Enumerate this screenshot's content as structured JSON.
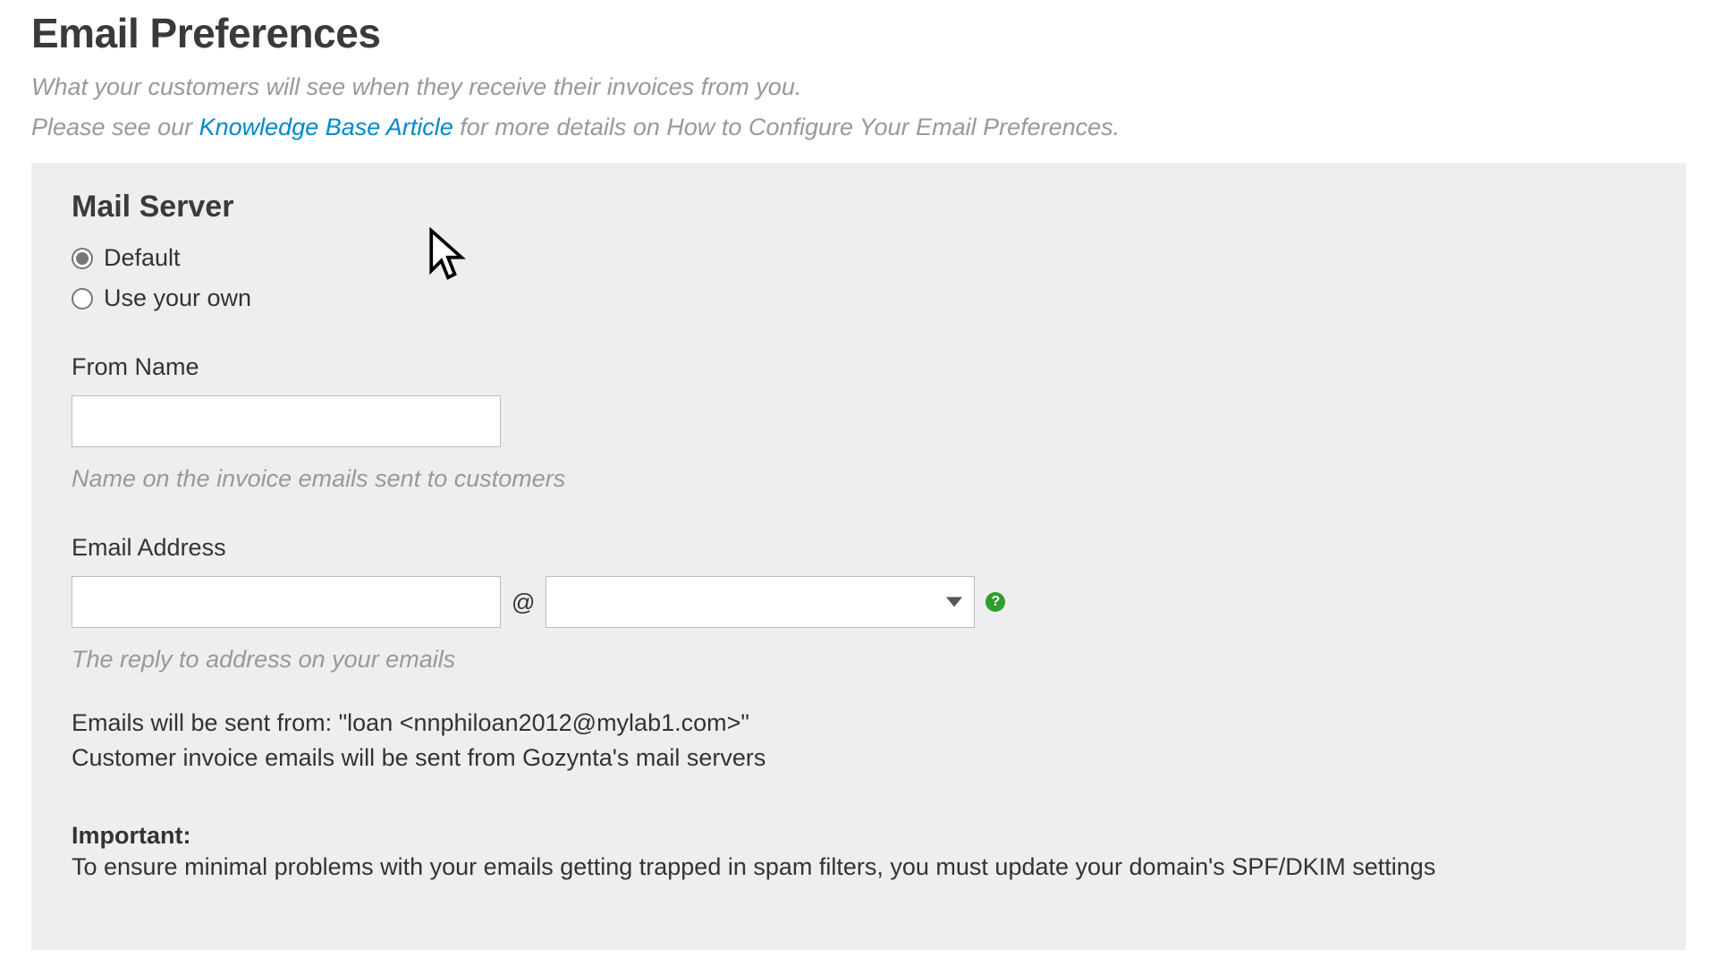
{
  "header": {
    "title": "Email Preferences",
    "subtitle": "What your customers will see when they receive their invoices from you.",
    "kb_prefix": "Please see our ",
    "kb_link": "Knowledge Base Article",
    "kb_suffix": " for more details on How to Configure Your Email Preferences."
  },
  "mailserver": {
    "section_title": "Mail Server",
    "option_default": "Default",
    "option_own": "Use your own",
    "selected": "default"
  },
  "from_name": {
    "label": "From Name",
    "value": "",
    "help": "Name on the invoice emails sent to customers"
  },
  "email_address": {
    "label": "Email Address",
    "local_value": "",
    "at": "@",
    "domain_value": "",
    "help": "The reply to address on your emails"
  },
  "info": {
    "sent_from": "Emails will be sent from: \"loan <nnphiloan2012@mylab1.com>\"",
    "server_note": "Customer invoice emails will be sent from Gozynta's mail servers"
  },
  "important": {
    "label": "Important:",
    "text": "To ensure minimal problems with your emails getting trapped in spam filters, you must update your domain's SPF/DKIM settings"
  }
}
